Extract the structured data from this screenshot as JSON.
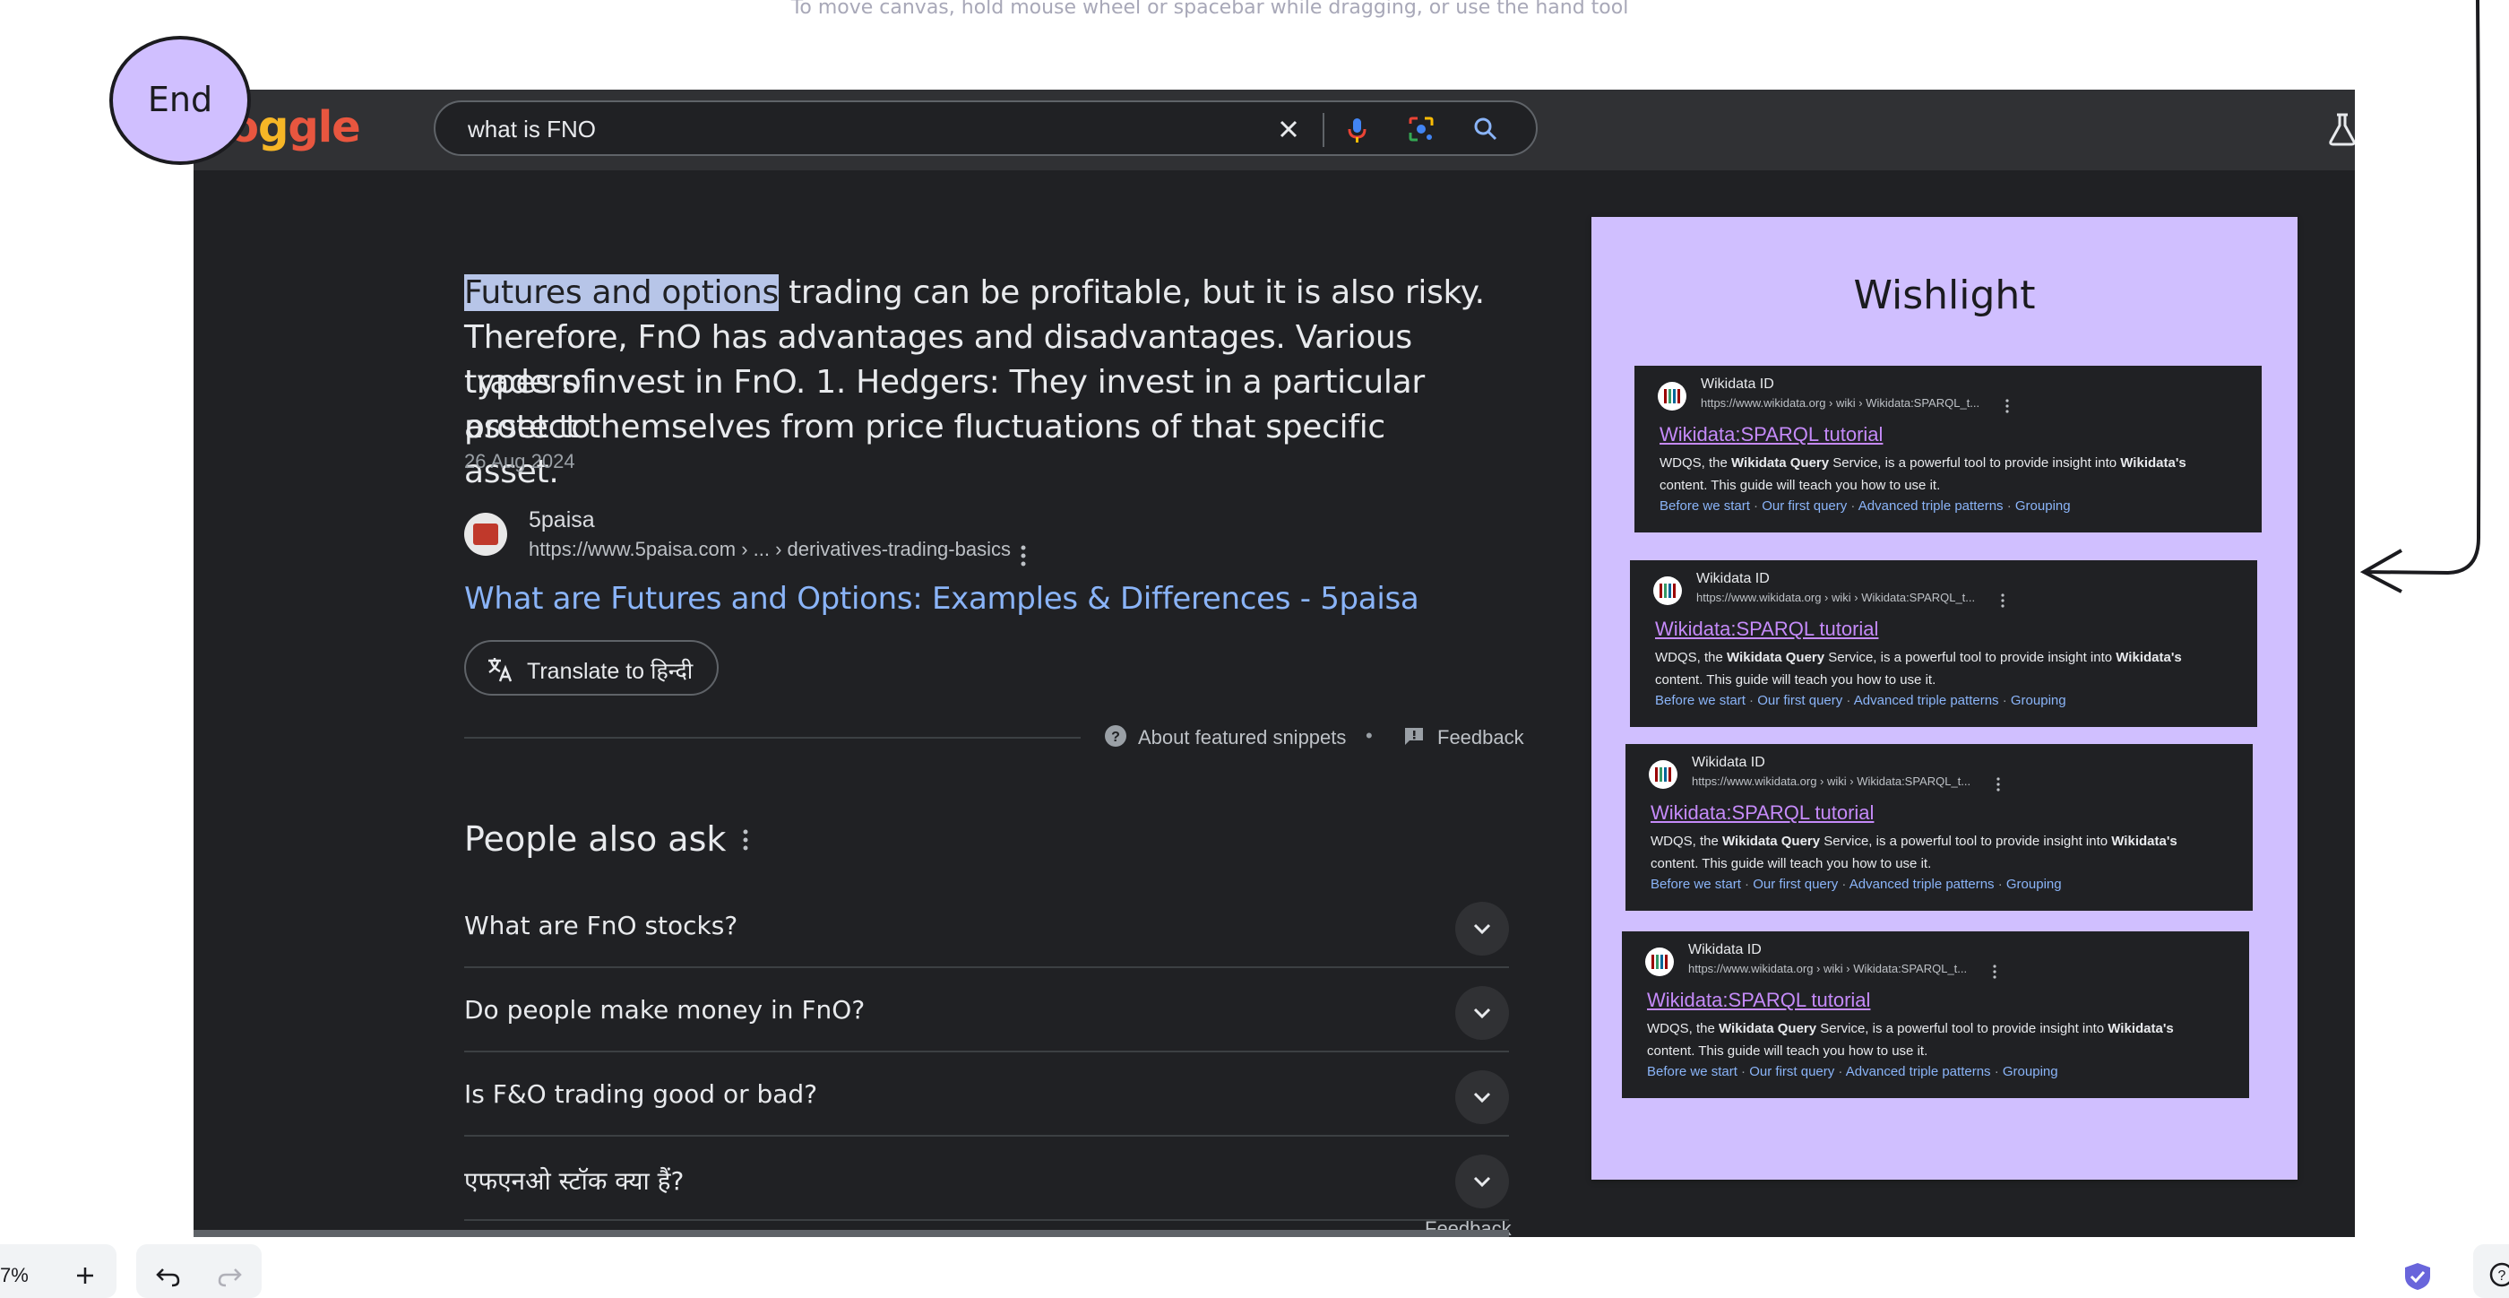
{
  "canvas": {
    "hint": "To move canvas, hold mouse wheel or spacebar while dragging, or use the hand tool",
    "end_label": "End",
    "zoom": "7%"
  },
  "search": {
    "query": "what is FNO"
  },
  "snippet": {
    "highlight": "Futures and options",
    "rest_line1": " trading can be profitable, but it is also risky.",
    "line2": "Therefore, FnO has advantages and disadvantages. Various types of",
    "line3": "traders invest in FnO. 1. Hedgers: They invest in a particular asset to",
    "line4": "protect themselves from price fluctuations of that specific asset.",
    "date": "26 Aug 2024",
    "source_name": "5paisa",
    "source_url": "https://www.5paisa.com › ... › derivatives-trading-basics",
    "link_title": "What are Futures and Options: Examples & Differences - 5paisa",
    "translate_label": "Translate to हिन्दी",
    "about_label": "About featured snippets",
    "feedback_label": "Feedback"
  },
  "people_also_ask": {
    "title": "People also ask",
    "questions": [
      "What are FnO stocks?",
      "Do people make money in FnO?",
      "Is F&O trading good or bad?",
      "एफएनओ स्टॉक क्या हैं?"
    ],
    "feedback_label": "Feedback"
  },
  "wishlist": {
    "title": "Wishlight",
    "cards": [
      {
        "site": "Wikidata ID",
        "url": "https://www.wikidata.org › wiki › Wikidata:SPARQL_t...",
        "title": "Wikidata:SPARQL tutorial",
        "desc_1": "WDQS, the ",
        "desc_bold_1": "Wikidata Query",
        "desc_2": " Service, is a powerful tool to provide insight into ",
        "desc_bold_2": "Wikidata's",
        "desc_3": "content. This guide will teach you how to use it.",
        "links": [
          "Before we start",
          "Our first query",
          "Advanced triple patterns",
          "Grouping"
        ]
      },
      {
        "site": "Wikidata ID",
        "url": "https://www.wikidata.org › wiki › Wikidata:SPARQL_t...",
        "title": "Wikidata:SPARQL tutorial",
        "desc_1": "WDQS, the ",
        "desc_bold_1": "Wikidata Query",
        "desc_2": " Service, is a powerful tool to provide insight into ",
        "desc_bold_2": "Wikidata's",
        "desc_3": "content. This guide will teach you how to use it.",
        "links": [
          "Before we start",
          "Our first query",
          "Advanced triple patterns",
          "Grouping"
        ]
      },
      {
        "site": "Wikidata ID",
        "url": "https://www.wikidata.org › wiki › Wikidata:SPARQL_t...",
        "title": "Wikidata:SPARQL tutorial",
        "desc_1": "WDQS, the ",
        "desc_bold_1": "Wikidata Query",
        "desc_2": " Service, is a powerful tool to provide insight into ",
        "desc_bold_2": "Wikidata's",
        "desc_3": "content. This guide will teach you how to use it.",
        "links": [
          "Before we start",
          "Our first query",
          "Advanced triple patterns",
          "Grouping"
        ]
      },
      {
        "site": "Wikidata ID",
        "url": "https://www.wikidata.org › wiki › Wikidata:SPARQL_t...",
        "title": "Wikidata:SPARQL tutorial",
        "desc_1": "WDQS, the ",
        "desc_bold_1": "Wikidata Query",
        "desc_2": " Service, is a powerful tool to provide insight into ",
        "desc_bold_2": "Wikidata's",
        "desc_3": "content. This guide will teach you how to use it.",
        "links": [
          "Before we start",
          "Our first query",
          "Advanced triple patterns",
          "Grouping"
        ]
      }
    ]
  },
  "colors": {
    "dark_bg": "#202124",
    "wishlist_bg": "#d0bfff",
    "link_blue": "#8ab4f8",
    "visited_purple": "#c58af9"
  }
}
